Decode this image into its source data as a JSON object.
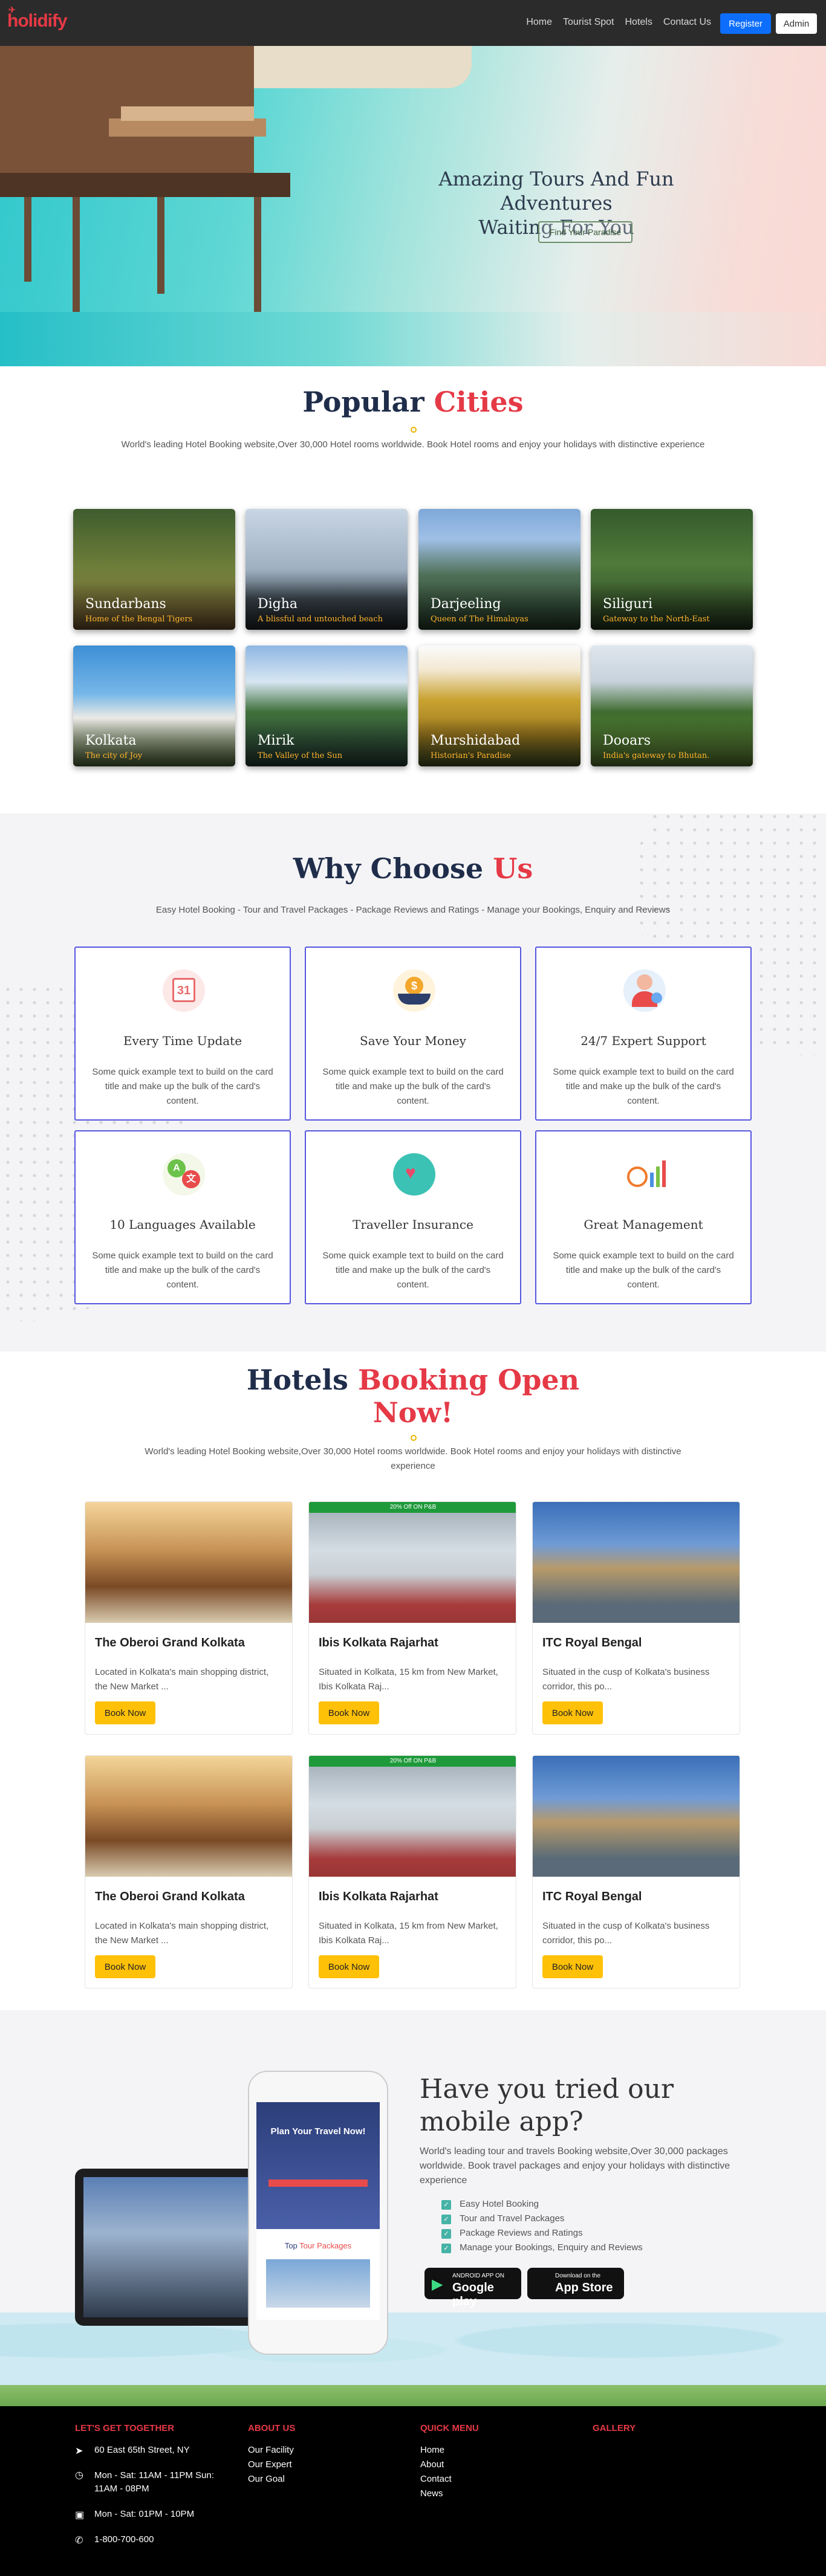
{
  "nav": {
    "logo": "holidify",
    "links": [
      "Home",
      "Tourist Spot",
      "Hotels",
      "Contact Us"
    ],
    "register": "Register",
    "admin": "Admin"
  },
  "hero": {
    "title_line1": "Amazing Tours And Fun Adventures",
    "title_line2": "Waiting For You",
    "button": "Find Your Paradise"
  },
  "cities": {
    "title_a": "Popular",
    "title_b": "Cities",
    "subtitle": "World's leading Hotel Booking website,Over 30,000 Hotel rooms worldwide. Book Hotel rooms and enjoy your holidays with distinctive experience",
    "items": [
      {
        "name": "Sundarbans",
        "tag": "Home of the Bengal Tigers"
      },
      {
        "name": "Digha",
        "tag": "A blissful and untouched beach"
      },
      {
        "name": "Darjeeling",
        "tag": "Queen of The Himalayas"
      },
      {
        "name": "Siliguri",
        "tag": "Gateway to the North-East"
      },
      {
        "name": "Kolkata",
        "tag": "The city of Joy"
      },
      {
        "name": "Mirik",
        "tag": "The Valley of the Sun"
      },
      {
        "name": "Murshidabad",
        "tag": "Historian's Paradise"
      },
      {
        "name": "Dooars",
        "tag": "India's gateway to Bhutan."
      }
    ]
  },
  "why": {
    "title_a": "Why Choose",
    "title_b": "Us",
    "subtitle": "Easy Hotel Booking - Tour and Travel Packages - Package Reviews and Ratings - Manage your Bookings, Enquiry and Reviews",
    "features": [
      {
        "title": "Every Time Update",
        "desc": "Some quick example text to build on the card title and make up the bulk of the card's content.",
        "icon": "calendar-icon"
      },
      {
        "title": "Save Your Money",
        "desc": "Some quick example text to build on the card title and make up the bulk of the card's content.",
        "icon": "money-hands-icon"
      },
      {
        "title": "24/7 Expert Support",
        "desc": "Some quick example text to build on the card title and make up the bulk of the card's content.",
        "icon": "support-agent-icon"
      },
      {
        "title": "10 Languages Available",
        "desc": "Some quick example text to build on the card title and make up the bulk of the card's content.",
        "icon": "languages-icon"
      },
      {
        "title": "Traveller Insurance",
        "desc": "Some quick example text to build on the card title and make up the bulk of the card's content.",
        "icon": "insurance-heart-icon"
      },
      {
        "title": "Great Management",
        "desc": "Some quick example text to build on the card title and make up the bulk of the card's content.",
        "icon": "management-chart-icon"
      }
    ]
  },
  "hotels": {
    "title_a": "Hotels",
    "title_b": "Booking Open",
    "title_c": "Now!",
    "subtitle": "World's leading Hotel Booking website,Over 30,000 Hotel rooms worldwide. Book Hotel rooms and enjoy your holidays with distinctive experience",
    "promo": "20% Off ON P&B",
    "book_label": "Book Now",
    "items": [
      {
        "name": "The Oberoi Grand Kolkata",
        "desc": "Located in Kolkata's main shopping district, the New Market ..."
      },
      {
        "name": "Ibis Kolkata Rajarhat",
        "desc": "Situated in Kolkata, 15 km from New Market, Ibis Kolkata Raj..."
      },
      {
        "name": "ITC Royal Bengal",
        "desc": "Situated in the cusp of Kolkata's business corridor, this po..."
      },
      {
        "name": "The Oberoi Grand Kolkata",
        "desc": "Located in Kolkata's main shopping district, the New Market ..."
      },
      {
        "name": "Ibis Kolkata Rajarhat",
        "desc": "Situated in Kolkata, 15 km from New Market, Ibis Kolkata Raj..."
      },
      {
        "name": "ITC Royal Bengal",
        "desc": "Situated in the cusp of Kolkata's business corridor, this po..."
      }
    ]
  },
  "app": {
    "title": "Have you tried our mobile app?",
    "desc": "World's leading tour and travels Booking website,Over 30,000 packages worldwide. Book travel packages and enjoy your holidays with distinctive experience",
    "features": [
      "Easy Hotel Booking",
      "Tour and Travel Packages",
      "Package Reviews and Ratings",
      "Manage your Bookings, Enquiry and Reviews"
    ],
    "google_small": "ANDROID APP ON",
    "google_big": "Google play",
    "apple_small": "Download on the",
    "apple_big": "App Store",
    "phone_heading": "Plan Your Travel Now!",
    "phone_top_a": "Top",
    "phone_top_b": "Tour Packages"
  },
  "footer": {
    "col1_title": "LET'S GET TOGETHER",
    "address": "60 East 65th Street, NY",
    "hours1": "Mon - Sat: 11AM - 11PM Sun: 11AM - 08PM",
    "hours2": "Mon - Sat: 01PM - 10PM",
    "phone": "1-800-700-600",
    "col2_title": "ABOUT US",
    "about": [
      "Our Facility",
      "Our Expert",
      "Our Goal"
    ],
    "col3_title": "QUICK MENU",
    "quick": [
      "Home",
      "About",
      "Contact",
      "News"
    ],
    "col4_title": "GALLERY"
  }
}
